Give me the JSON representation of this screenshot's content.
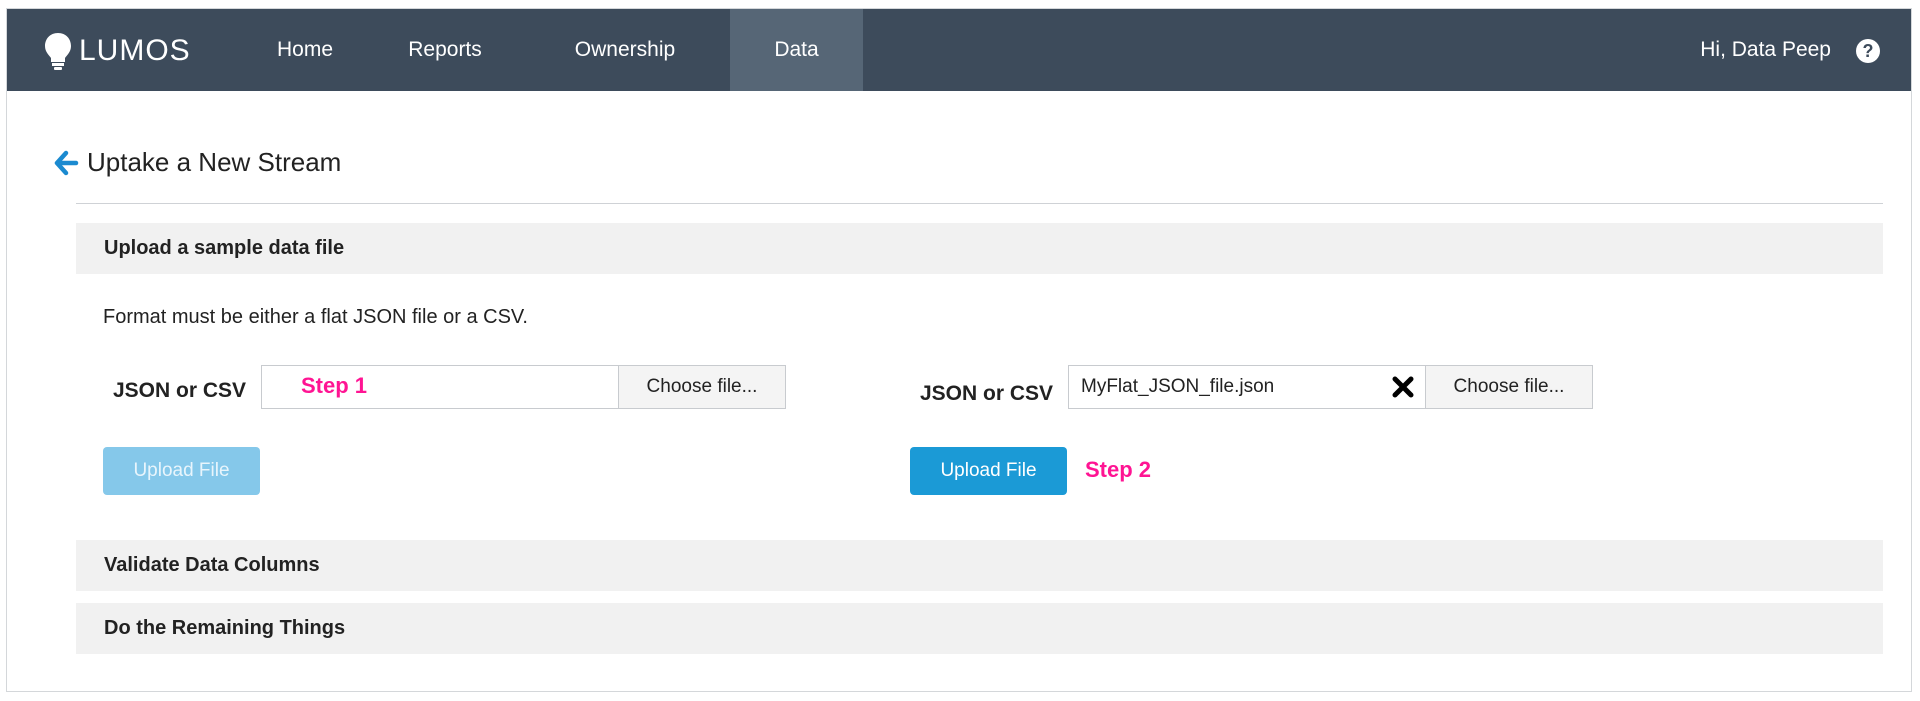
{
  "app": {
    "brand": "LUMOS"
  },
  "nav": {
    "items": [
      {
        "label": "Home"
      },
      {
        "label": "Reports"
      },
      {
        "label": "Ownership"
      },
      {
        "label": "Data",
        "active": true
      }
    ],
    "greeting": "Hi, Data Peep",
    "help_icon": "question-circle-icon"
  },
  "page": {
    "title": "Uptake a New Stream",
    "back_icon": "arrow-left-icon"
  },
  "sections": {
    "upload": {
      "title": "Upload a sample data file",
      "hint": "Format must be either a flat JSON file or a CSV."
    },
    "validate": {
      "title": "Validate Data Columns"
    },
    "remaining": {
      "title": "Do the Remaining Things"
    }
  },
  "step1": {
    "field_label": "JSON or CSV",
    "file_value": "",
    "choose_label": "Choose file...",
    "upload_label": "Upload File",
    "upload_state": "disabled",
    "annotation": "Step 1"
  },
  "step2": {
    "field_label": "JSON or CSV",
    "file_value": "MyFlat_JSON_file.json",
    "clear_icon": "close-x-icon",
    "choose_label": "Choose file...",
    "upload_label": "Upload File",
    "upload_state": "enabled",
    "annotation": "Step 2"
  },
  "colors": {
    "navbar": "#3d4b5b",
    "nav_active": "#566676",
    "accent": "#1b9ad6",
    "accent_disabled": "#85c8ea",
    "annotation": "#ff1493",
    "back_arrow": "#1b8ad0"
  }
}
